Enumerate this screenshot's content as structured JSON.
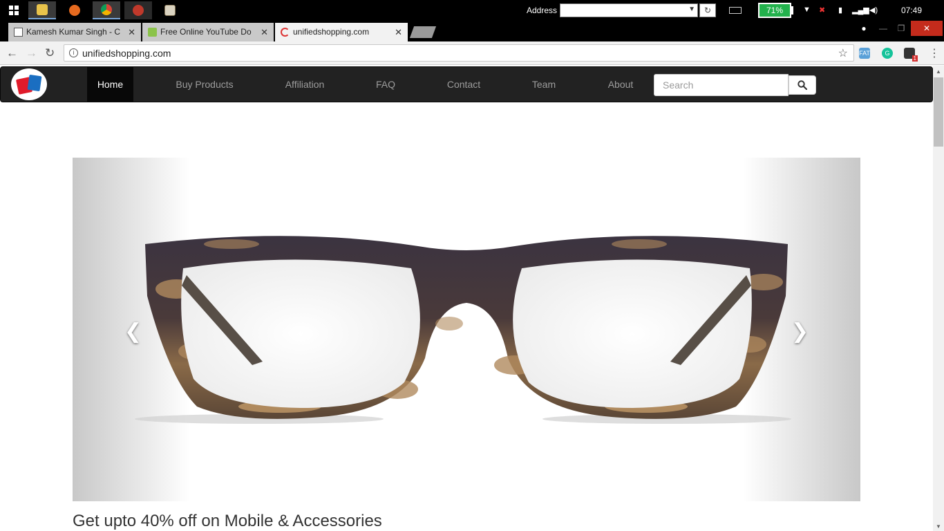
{
  "taskbar": {
    "address_label": "Address",
    "address_value": "",
    "battery": "71%",
    "clock": "07:49"
  },
  "tabs": [
    {
      "title": "Kamesh Kumar Singh - C",
      "close": "✕"
    },
    {
      "title": "Free Online YouTube Do",
      "close": "✕"
    },
    {
      "title": "unifiedshopping.com",
      "close": "✕"
    }
  ],
  "omnibox": {
    "url": "unifiedshopping.com"
  },
  "extensions": {
    "ext_badge": "1"
  },
  "site": {
    "nav": [
      "Home",
      "Buy Products",
      "Affiliation",
      "FAQ",
      "Contact",
      "Team",
      "About"
    ],
    "search_placeholder": "Search"
  },
  "carousel": {
    "caption": "Get upto 40% off on Mobile & Accessories",
    "prev": "❮",
    "next": "❯"
  },
  "colors": {
    "navbar": "#222222",
    "battery": "#22b14c",
    "frame_dark": "#3b3340",
    "tortoise": "#b08a5e"
  }
}
